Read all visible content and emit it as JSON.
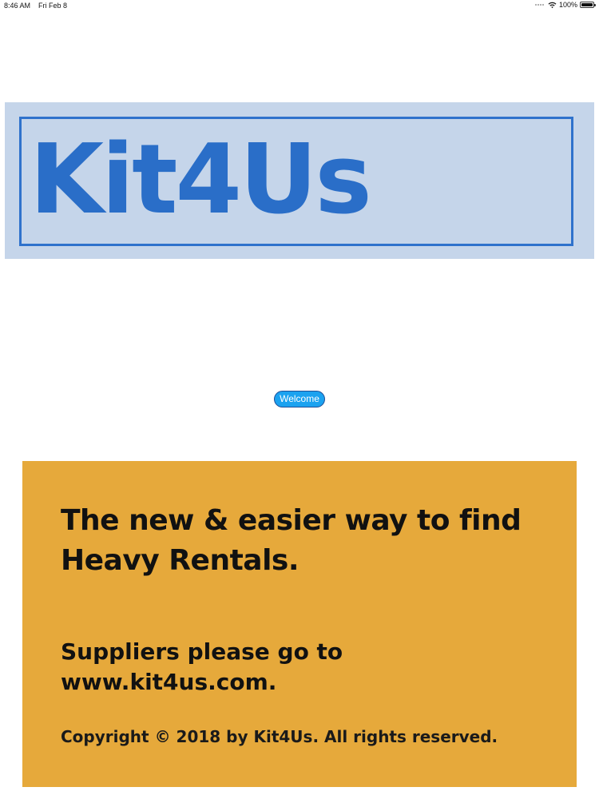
{
  "status_bar": {
    "time": "8:46 AM",
    "date": "Fri Feb 8",
    "battery_percent": "100%",
    "battery_level": 1.0
  },
  "logo": {
    "text": "Kit4Us",
    "background_color": "#c5d5ea",
    "text_color": "#2a6ec8"
  },
  "welcome_button": {
    "label": "Welcome",
    "color": "#1ba2f0"
  },
  "info_panel": {
    "background_color": "#e6a93b",
    "tagline_line1": "The new & easier way to find",
    "tagline_line2": "Heavy Rentals.",
    "suppliers_line1": "Suppliers please go to",
    "suppliers_line2": "www.kit4us.com.",
    "copyright": "Copyright  © 2018 by Kit4Us. All rights reserved."
  }
}
